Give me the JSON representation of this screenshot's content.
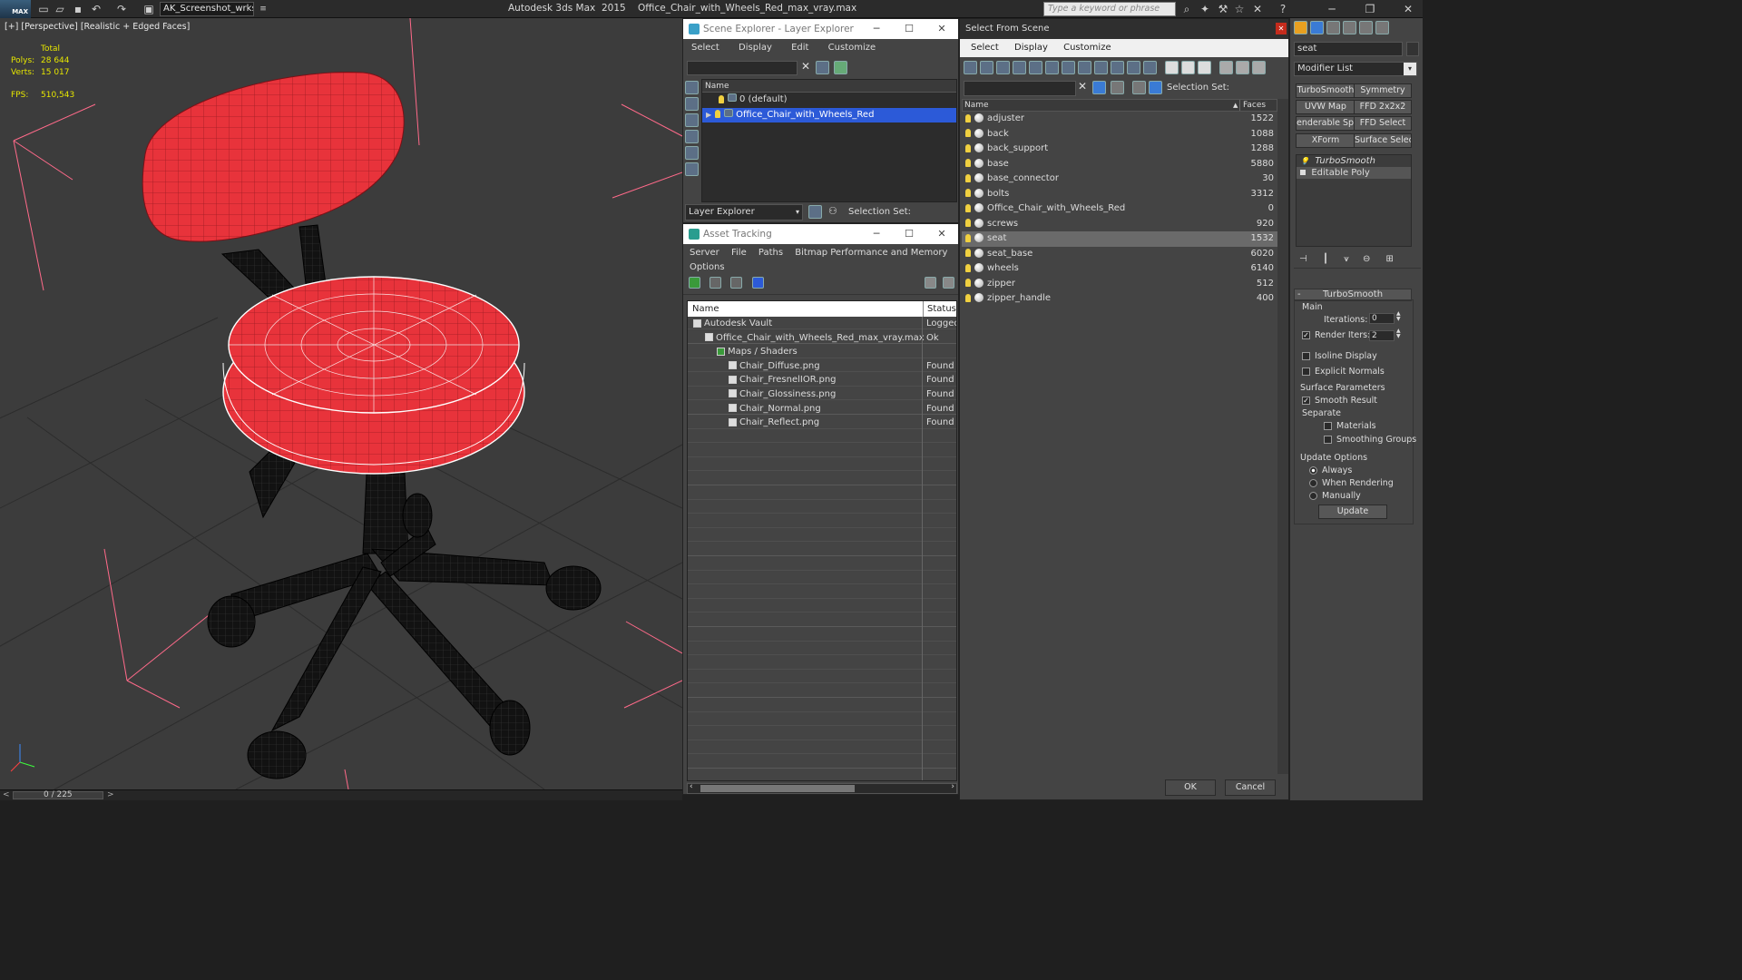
{
  "titlebar": {
    "logo": "MAX",
    "workspace": "AK_Screenshot_wrksp",
    "app_name": "Autodesk 3ds Max",
    "app_version": "2015",
    "file": "Office_Chair_with_Wheels_Red_max_vray.max",
    "search_placeholder": "Type a keyword or phrase"
  },
  "viewport": {
    "label": "[+] [Perspective] [Realistic + Edged Faces]",
    "stats": {
      "header": "Total",
      "polys_label": "Polys:",
      "polys": "28 644",
      "verts_label": "Verts:",
      "verts": "15 017",
      "fps_label": "FPS:",
      "fps": "510,543"
    },
    "time_counter": "0 / 225",
    "colors": {
      "seat": "#e8333b",
      "frame": "#111111",
      "background": "#3c3c3c"
    }
  },
  "scene_explorer": {
    "title": "Scene Explorer - Layer Explorer",
    "menu": [
      "Select",
      "Display",
      "Edit",
      "Customize"
    ],
    "column_name": "Name",
    "layers": [
      {
        "name": "0 (default)",
        "selected": false
      },
      {
        "name": "Office_Chair_with_Wheels_Red",
        "selected": true
      }
    ],
    "footer_dropdown": "Layer Explorer",
    "selection_set_label": "Selection Set:"
  },
  "asset_tracking": {
    "title": "Asset Tracking",
    "menu": [
      "Server",
      "File",
      "Paths",
      "Bitmap Performance and Memory",
      "Options"
    ],
    "columns": {
      "name": "Name",
      "status": "Status"
    },
    "rows": [
      {
        "name": "Autodesk Vault",
        "status": "Logged",
        "indent": 1
      },
      {
        "name": "Office_Chair_with_Wheels_Red_max_vray.max",
        "status": "Ok",
        "indent": 2
      },
      {
        "name": "Maps / Shaders",
        "status": "",
        "indent": 3
      },
      {
        "name": "Chair_Diffuse.png",
        "status": "Found",
        "indent": 4
      },
      {
        "name": "Chair_FresnelIOR.png",
        "status": "Found",
        "indent": 4
      },
      {
        "name": "Chair_Glossiness.png",
        "status": "Found",
        "indent": 4
      },
      {
        "name": "Chair_Normal.png",
        "status": "Found",
        "indent": 4
      },
      {
        "name": "Chair_Reflect.png",
        "status": "Found",
        "indent": 4
      }
    ]
  },
  "select_from_scene": {
    "title": "Select From Scene",
    "menu": [
      "Select",
      "Display",
      "Customize"
    ],
    "selection_set_label": "Selection Set:",
    "columns": {
      "name": "Name",
      "faces": "Faces"
    },
    "objects": [
      {
        "name": "adjuster",
        "faces": "1522",
        "selected": false
      },
      {
        "name": "back",
        "faces": "1088",
        "selected": false
      },
      {
        "name": "back_support",
        "faces": "1288",
        "selected": false
      },
      {
        "name": "base",
        "faces": "5880",
        "selected": false
      },
      {
        "name": "base_connector",
        "faces": "30",
        "selected": false
      },
      {
        "name": "bolts",
        "faces": "3312",
        "selected": false
      },
      {
        "name": "Office_Chair_with_Wheels_Red",
        "faces": "0",
        "selected": false
      },
      {
        "name": "screws",
        "faces": "920",
        "selected": false
      },
      {
        "name": "seat",
        "faces": "1532",
        "selected": true
      },
      {
        "name": "seat_base",
        "faces": "6020",
        "selected": false
      },
      {
        "name": "wheels",
        "faces": "6140",
        "selected": false
      },
      {
        "name": "zipper",
        "faces": "512",
        "selected": false
      },
      {
        "name": "zipper_handle",
        "faces": "400",
        "selected": false
      }
    ],
    "ok_label": "OK",
    "cancel_label": "Cancel"
  },
  "command_panel": {
    "object_name": "seat",
    "modifier_list": "Modifier List",
    "mod_buttons": [
      "TurboSmooth",
      "Symmetry",
      "UVW Map",
      "FFD 2x2x2",
      "enderable Splin",
      "FFD Select",
      "XForm",
      "Surface Select"
    ],
    "stack": [
      "TurboSmooth",
      "Editable Poly"
    ],
    "rollout_title": "TurboSmooth",
    "main_label": "Main",
    "iterations_label": "Iterations:",
    "iterations": "0",
    "render_iters_label": "Render Iters:",
    "render_iters": "2",
    "isoline_label": "Isoline Display",
    "explicit_normals_label": "Explicit Normals",
    "surface_params_label": "Surface Parameters",
    "smooth_result_label": "Smooth Result",
    "separate_label": "Separate",
    "materials_label": "Materials",
    "smoothing_groups_label": "Smoothing Groups",
    "update_options_label": "Update Options",
    "always_label": "Always",
    "when_rendering_label": "When Rendering",
    "manually_label": "Manually",
    "update_button": "Update"
  }
}
